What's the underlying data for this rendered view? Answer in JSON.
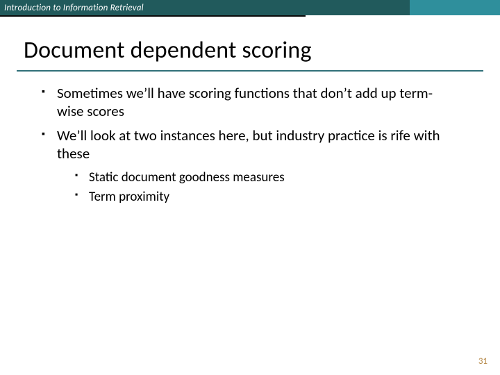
{
  "header": {
    "course": "Introduction to Information Retrieval"
  },
  "title": "Document dependent scoring",
  "bullets": [
    {
      "text": "Sometimes we’ll have scoring functions that don’t add up term-wise scores"
    },
    {
      "text": "We’ll look at two instances here, but industry practice is rife with these",
      "sub": [
        "Static document goodness measures",
        "Term proximity"
      ]
    }
  ],
  "page_number": "31"
}
